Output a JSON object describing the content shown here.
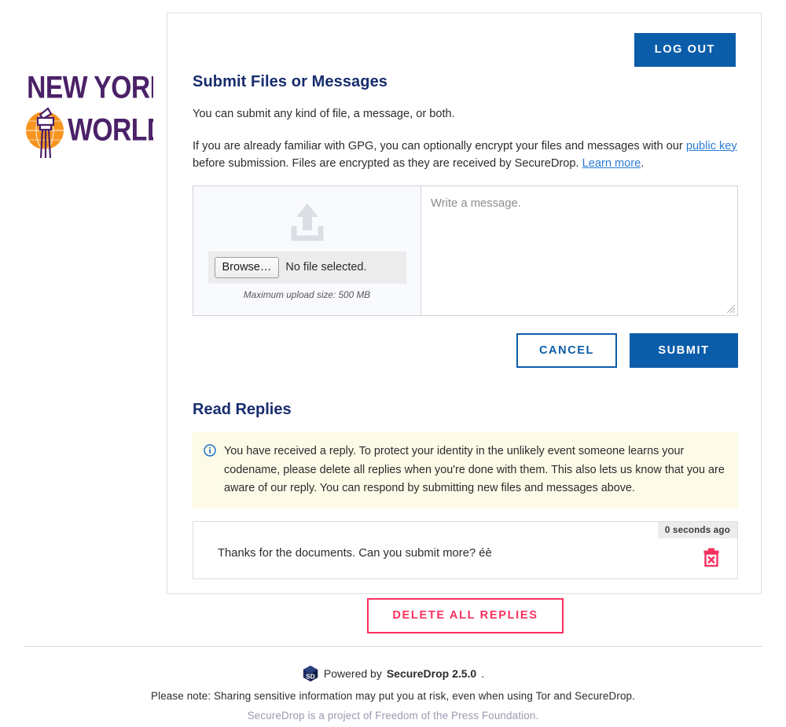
{
  "brand": {
    "logo_line1": "NEW YORK",
    "logo_line2": "WORLD",
    "logo_purple": "#4b2168",
    "logo_orange": "#f7941e"
  },
  "header": {
    "logout_label": "LOG OUT"
  },
  "submit_section": {
    "heading": "Submit Files or Messages",
    "intro": "You can submit any kind of file, a message, or both.",
    "gpg_part1": "If you are already familiar with GPG, you can optionally encrypt your files and messages with our ",
    "gpg_link1": "public key",
    "gpg_part2": " before submission. Files are encrypted as they are received by SecureDrop. ",
    "gpg_link2": "Learn more",
    "gpg_part3": ".",
    "upload": {
      "icon": "upload-arrow-tray-icon",
      "browse_label": "Browse…",
      "file_status": "No file selected.",
      "max_size": "Maximum upload size: 500 MB"
    },
    "message": {
      "placeholder": "Write a message.",
      "value": ""
    },
    "cancel_label": "CANCEL",
    "submit_label": "SUBMIT"
  },
  "replies_section": {
    "heading": "Read Replies",
    "notice_icon": "info-circle-icon",
    "notice": "You have received a reply. To protect your identity in the unlikely event someone learns your codename, please delete all replies when you're done with them. This also lets us know that you are aware of our reply. You can respond by submitting new files and messages above.",
    "replies": [
      {
        "timestamp": "0 seconds ago",
        "text": "Thanks for the documents. Can you submit more? éè",
        "delete_icon": "trash-can-icon"
      }
    ],
    "delete_all_label": "DELETE ALL REPLIES"
  },
  "footer": {
    "sd_icon": "securedrop-cube-icon",
    "powered_prefix": "Powered by ",
    "powered_name": "SecureDrop 2.5.0",
    "powered_suffix": ".",
    "note": "Please note: Sharing sensitive information may put you at risk, even when using Tor and SecureDrop.",
    "fpf": "SecureDrop is a project of Freedom of the Press Foundation."
  },
  "colors": {
    "primary_blue": "#0b5daa",
    "heading_navy": "#172d6e",
    "link_blue": "#2b7bd4",
    "danger_pink": "#f8315f",
    "notice_bg": "#fdfbe8"
  }
}
